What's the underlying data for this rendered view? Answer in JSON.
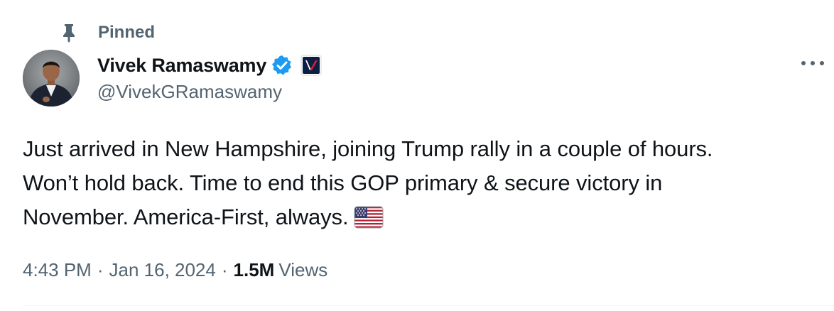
{
  "pinned": {
    "label": "Pinned",
    "icon": "pin-icon"
  },
  "author": {
    "display_name": "Vivek Ramaswamy",
    "handle": "@VivekGRamaswamy",
    "verified_icon": "verified-badge-icon",
    "affiliate_badge": "affiliate-badge-icon",
    "avatar": "profile-avatar"
  },
  "more_menu": {
    "icon": "more-options-icon"
  },
  "tweet": {
    "lines": [
      "Just arrived in New Hampshire, joining Trump rally in a couple of hours.",
      "Won’t hold back. Time to end this GOP primary & secure victory in",
      "November. America-First, always."
    ],
    "emoji": "us-flag-icon"
  },
  "meta": {
    "time": "4:43 PM",
    "separator": "·",
    "date": "Jan 16, 2024",
    "views_count": "1.5M",
    "views_label": "Views"
  },
  "colors": {
    "text_primary": "#0f1419",
    "text_secondary": "#536471",
    "verified_blue": "#1d9bf0",
    "divider": "#eff3f4"
  }
}
